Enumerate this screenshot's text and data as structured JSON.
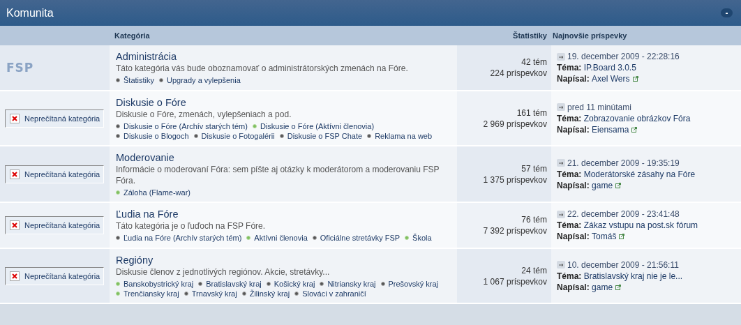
{
  "section": {
    "title": "Komunita",
    "collapse": "-"
  },
  "columns": [
    "Kategória",
    "Štatistiky",
    "Najnovšie príspevky"
  ],
  "rows": [
    {
      "icon": {
        "kind": "logo",
        "text": "FSP"
      },
      "title": "Administrácia",
      "description": "Táto kategória vás bude oboznamovať o administrátorských zmenách na Fóre.",
      "subforums": [
        {
          "name": "Štatistiky",
          "unread": false
        },
        {
          "name": "Upgrady a vylepšenia",
          "unread": false
        }
      ],
      "topics": "42 tém",
      "posts": "224 príspevkov",
      "last": {
        "date": "19. december 2009 - 22:28:16",
        "topic_label": "Téma:",
        "topic": "IP.Board 3.0.5",
        "author_label": "Napísal:",
        "author": "Axel Wers"
      }
    },
    {
      "icon": {
        "kind": "unread",
        "text": "Neprečítaná kategória"
      },
      "title": "Diskusie o Fóre",
      "description": "Diskusie o Fóre, zmenách, vylepšeniach a pod.",
      "subforums": [
        {
          "name": "Diskusie o Fóre (Archív starých tém)",
          "unread": false
        },
        {
          "name": "Diskusie o Fóre (Aktívni členovia)",
          "unread": true
        },
        {
          "name": "Diskusie o Blogoch",
          "unread": false
        },
        {
          "name": "Diskusie o Fotogalérii",
          "unread": false
        },
        {
          "name": "Diskusie o FSP Chate",
          "unread": false
        },
        {
          "name": "Reklama na web",
          "unread": false
        }
      ],
      "topics": "161 tém",
      "posts": "2 969 príspevkov",
      "last": {
        "date": "pred 11 minútami",
        "topic_label": "Téma:",
        "topic": "Zobrazovanie obrázkov Fóra",
        "author_label": "Napísal:",
        "author": "Eiensama"
      }
    },
    {
      "icon": {
        "kind": "unread",
        "text": "Neprečítaná kategória"
      },
      "title": "Moderovanie",
      "description": "Informácie o moderovaní Fóra: sem píšte aj otázky k moderátorom a moderovaniu FSP Fóra.",
      "subforums": [
        {
          "name": "Záloha (Flame-war)",
          "unread": true
        }
      ],
      "topics": "57 tém",
      "posts": "1 375 príspevkov",
      "last": {
        "date": "21. december 2009 - 19:35:19",
        "topic_label": "Téma:",
        "topic": "Moderátorské zásahy na Fóre",
        "author_label": "Napísal:",
        "author": "game"
      }
    },
    {
      "icon": {
        "kind": "unread",
        "text": "Neprečítaná kategória"
      },
      "title": "Ľudia na Fóre",
      "description": "Táto kategória je o ľuďoch na FSP Fóre.",
      "subforums": [
        {
          "name": "Ľudia na Fóre (Archív starých tém)",
          "unread": false
        },
        {
          "name": "Aktívni členovia",
          "unread": true
        },
        {
          "name": "Oficiálne stretávky FSP",
          "unread": false
        },
        {
          "name": "Škola",
          "unread": true
        }
      ],
      "topics": "76 tém",
      "posts": "7 392 príspevkov",
      "last": {
        "date": "22. december 2009 - 23:41:48",
        "topic_label": "Téma:",
        "topic": "Zákaz vstupu na post.sk fórum",
        "author_label": "Napísal:",
        "author": "Tomáš"
      }
    },
    {
      "icon": {
        "kind": "unread",
        "text": "Neprečítaná kategória"
      },
      "title": "Regióny",
      "description": "Diskusie členov z jednotlivých regiónov. Akcie, stretávky...",
      "subforums": [
        {
          "name": "Banskobystrický kraj",
          "unread": true
        },
        {
          "name": "Bratislavský kraj",
          "unread": false
        },
        {
          "name": "Košický kraj",
          "unread": false
        },
        {
          "name": "Nitriansky kraj",
          "unread": false
        },
        {
          "name": "Prešovský kraj",
          "unread": false
        },
        {
          "name": "Trenčiansky kraj",
          "unread": true
        },
        {
          "name": "Trnavský kraj",
          "unread": false
        },
        {
          "name": "Žilinský kraj",
          "unread": false
        },
        {
          "name": "Slováci v zahraničí",
          "unread": false
        }
      ],
      "topics": "24 tém",
      "posts": "1 067 príspevkov",
      "last": {
        "date": "10. december 2009 - 21:56:11",
        "topic_label": "Téma:",
        "topic": "Bratislavský kraj nie je le...",
        "author_label": "Napísal:",
        "author": "game"
      }
    }
  ]
}
